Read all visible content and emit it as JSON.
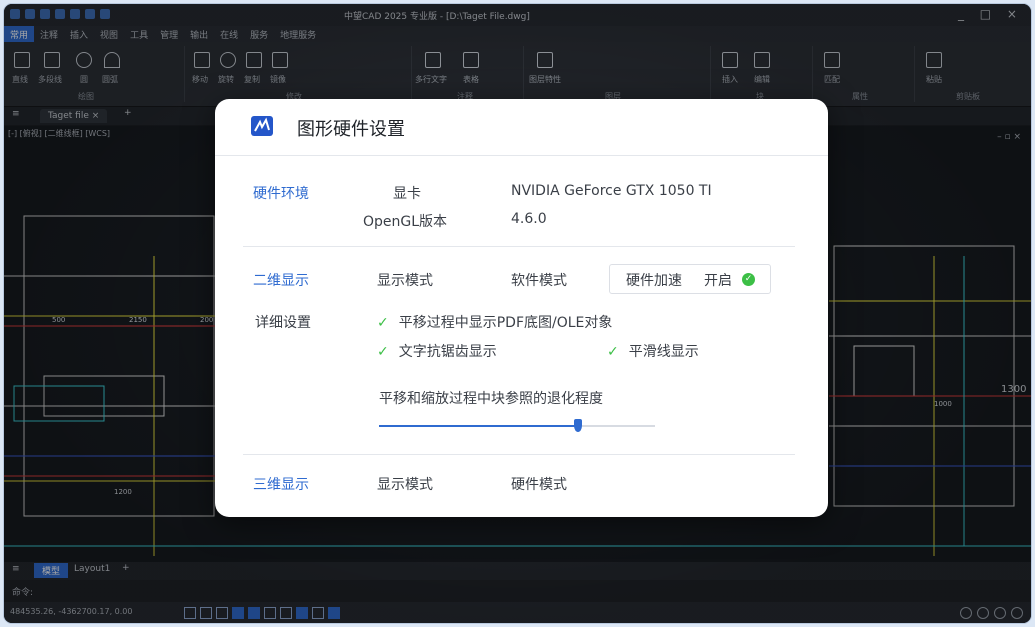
{
  "app": {
    "title": "中望CAD 2025 专业版 - [D:\\Taget File.dwg]",
    "menu_tabs": [
      "常用",
      "注释",
      "插入",
      "视图",
      "工具",
      "管理",
      "输出",
      "在线",
      "服务",
      "地理服务"
    ],
    "ribbon_groups": [
      "绘图",
      "修改",
      "注释",
      "图层",
      "块",
      "属性",
      "剪贴板"
    ],
    "ribbon_tools": [
      "直线",
      "多段线",
      "圆",
      "圆弧",
      "移动",
      "旋转",
      "复制",
      "镜像",
      "多行文字",
      "表格",
      "图层特性",
      "插入",
      "编辑",
      "匹配",
      "粘贴"
    ],
    "doc_tab": "Taget file",
    "view_label": "[-] [俯视] [二维线框] [WCS]",
    "layout_tabs": [
      "模型",
      "Layout1"
    ],
    "command_prompt": "命令:",
    "coordinates": "484535.26, -4362700.17, 0.00",
    "drawing_dims": [
      "500",
      "2150",
      "200",
      "1200",
      "1300",
      "1000"
    ]
  },
  "dialog": {
    "title": "图形硬件设置",
    "hardware": {
      "section": "硬件环境",
      "gpu_label": "显卡",
      "gpu_value": "NVIDIA GeForce GTX  1050  TI",
      "opengl_label": "OpenGL版本",
      "opengl_value": "4.6.0"
    },
    "display2d": {
      "section": "二维显示",
      "mode_label": "显示模式",
      "mode_value": "软件模式",
      "hw_accel_label": "硬件加速",
      "hw_accel_value": "开启",
      "detail_label": "详细设置",
      "option_pdf": "平移过程中显示PDF底图/OLE对象",
      "option_text_aa": "文字抗锯齿显示",
      "option_smooth": "平滑线显示",
      "slider_label": "平移和缩放过程中块参照的退化程度",
      "slider_value": 0.72
    },
    "display3d": {
      "section": "三维显示",
      "mode_label": "显示模式",
      "mode_value": "硬件模式"
    }
  },
  "colors": {
    "accent": "#2f6bd0",
    "check": "#3cbf46"
  }
}
